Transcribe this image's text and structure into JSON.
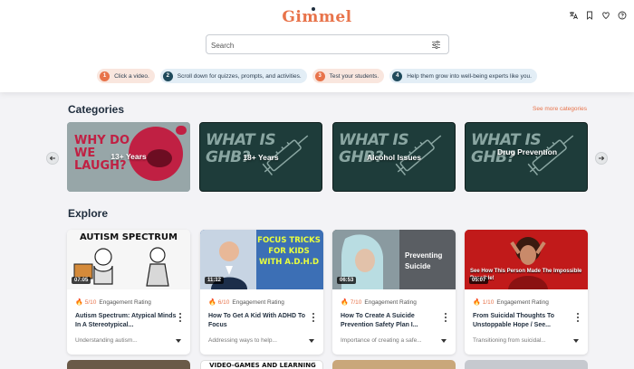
{
  "header": {
    "logo": "Gimmel",
    "search": {
      "placeholder": "Search"
    },
    "steps": [
      {
        "num": "1",
        "text": "Click a video."
      },
      {
        "num": "2",
        "text": "Scroll down for quizzes, prompts, and activities."
      },
      {
        "num": "3",
        "text": "Test your students."
      },
      {
        "num": "4",
        "text": "Help them grow into well-being experts like you."
      }
    ]
  },
  "categories": {
    "title": "Categories",
    "see_more": "See more categories",
    "items": [
      {
        "label": "13+ Years"
      },
      {
        "label": "18+ Years"
      },
      {
        "label": "Alcohol Issues"
      },
      {
        "label": "Drug Prevention"
      }
    ]
  },
  "explore": {
    "title": "Explore",
    "rating_label": "Engagement Rating",
    "videos": [
      {
        "thumb_text": "AUTISM SPECTRUM",
        "duration": "07:05",
        "score": "5/10",
        "title": "Autism Spectrum: Atypical Minds In A Stereotypical...",
        "description": "Understanding autism..."
      },
      {
        "thumb_text": "FOCUS TRICKS FOR KIDS WITH A.D.H.D",
        "duration": "11:12",
        "score": "6/10",
        "title": "How To Get A Kid With ADHD To Focus",
        "description": "Addressing ways to help..."
      },
      {
        "thumb_text": "Preventing Suicide",
        "duration": "06:53",
        "score": "7/10",
        "title": "How To Create A Suicide Prevention Safety Plan I...",
        "description": "Importance of creating a safe..."
      },
      {
        "thumb_text": "See How This Person Made The Impossible Possible!",
        "duration": "05:07",
        "score": "1/10",
        "title": "From Suicidal Thoughts To Unstoppable Hope / See...",
        "description": "Transitioning from suicidal..."
      }
    ],
    "row2_text": "VIDEO-GAMES AND LEARNING"
  },
  "thumb_text": {
    "why": "WHY DO WE LAUGH?",
    "ghb": "WHAT IS GHB?"
  },
  "colors": {
    "accent": "#e8734a",
    "navy": "#1f4a5c",
    "ghb_bg": "#1e3c3a"
  }
}
